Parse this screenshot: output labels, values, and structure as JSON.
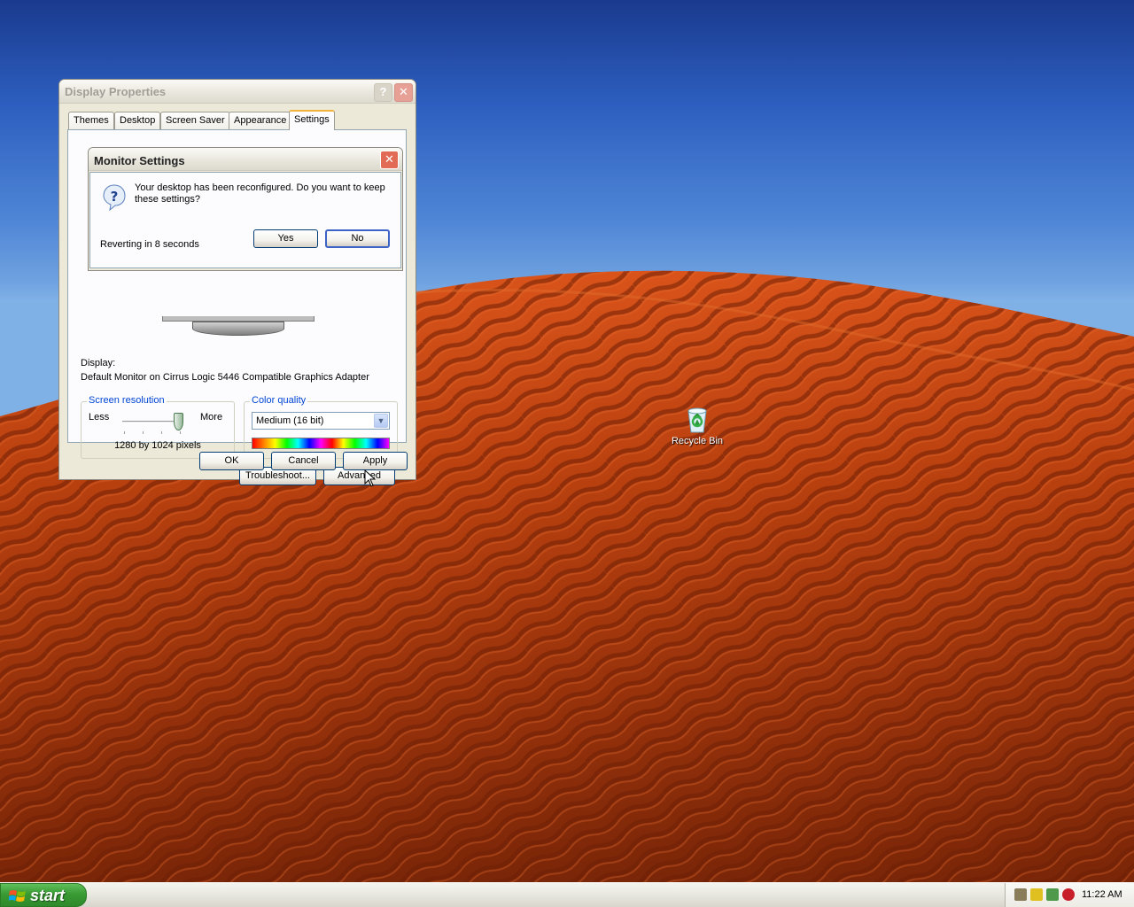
{
  "desktop": {
    "recycle_bin_label": "Recycle Bin"
  },
  "display_properties": {
    "title": "Display Properties",
    "help_glyph": "?",
    "close_glyph": "✕",
    "tabs": [
      {
        "label": "Themes"
      },
      {
        "label": "Desktop"
      },
      {
        "label": "Screen Saver"
      },
      {
        "label": "Appearance"
      },
      {
        "label": "Settings",
        "active": true
      }
    ],
    "display_label": "Display:",
    "display_value": "Default Monitor on Cirrus Logic 5446 Compatible Graphics Adapter",
    "screen_resolution": {
      "legend": "Screen resolution",
      "less_label": "Less",
      "more_label": "More",
      "value": "1280 by 1024 pixels",
      "slider_level": 1.0
    },
    "color_quality": {
      "legend": "Color quality",
      "selected": "Medium (16 bit)",
      "arrow_glyph": "▼"
    },
    "buttons": {
      "troubleshoot": "Troubleshoot...",
      "advanced": "Advanced",
      "ok": "OK",
      "cancel": "Cancel",
      "apply": "Apply"
    }
  },
  "monitor_settings": {
    "title": "Monitor Settings",
    "close_glyph": "✕",
    "icon": "question-icon",
    "message": "Your desktop has been reconfigured.  Do you want to keep these settings?",
    "countdown": "Reverting in 8 seconds",
    "yes_label": "Yes",
    "no_label": "No"
  },
  "taskbar": {
    "start_label": "start",
    "clock": "11:22 AM",
    "tray_icons": [
      "network-icon",
      "warning-icon",
      "security-icon",
      "shield-icon"
    ]
  },
  "colors": {
    "sky_top": "#1a3a8e",
    "sand": "#c2410f",
    "start_green": "#3a9a34",
    "tab_highlight": "#f2b33d",
    "legend_blue": "#0046d5"
  }
}
